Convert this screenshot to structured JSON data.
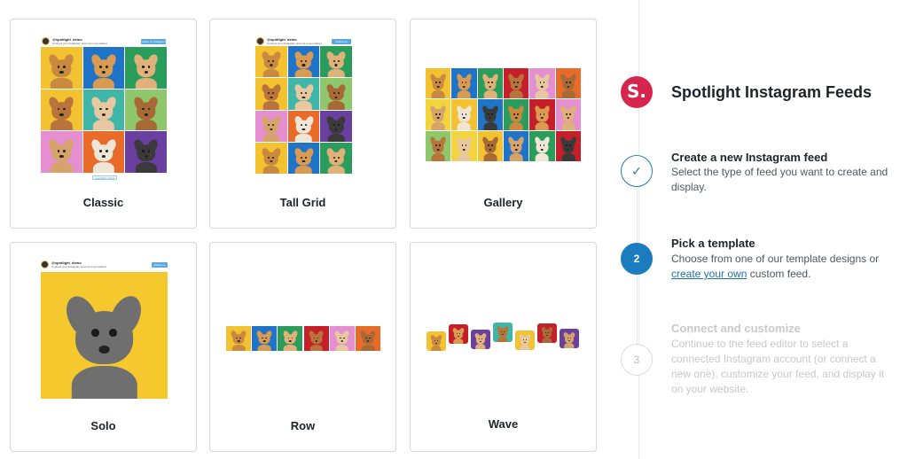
{
  "templates": [
    {
      "name": "Classic"
    },
    {
      "name": "Tall Grid"
    },
    {
      "name": "Gallery"
    },
    {
      "name": "Solo"
    },
    {
      "name": "Row"
    },
    {
      "name": "Wave"
    }
  ],
  "preview_text": {
    "username": "@spotlight_demo",
    "bio": "Connect your Instagram account to get started",
    "follow": "Follow on Instagram",
    "load_more": "Load More Posts"
  },
  "brand": {
    "logo": "S.",
    "logo_color": "#d7264d",
    "title": "Spotlight Instagram Feeds"
  },
  "steps": [
    {
      "badge": "✓",
      "title": "Create a new Instagram feed",
      "description": "Select the type of feed you want to create and display.",
      "state": "done"
    },
    {
      "badge": "2",
      "title": "Pick a template",
      "description_before": "Choose from one of our template designs or",
      "link": "create your own",
      "description_after": "custom feed.",
      "state": "active"
    },
    {
      "badge": "3",
      "title": "Connect and customize",
      "description": "Continue to the feed editor to select a connected Instagram account (or connect a new one), customize your feed, and display it on your website.",
      "state": "upcoming"
    }
  ],
  "colors": {
    "accent": "#1b7cc0",
    "link": "#2271b1"
  }
}
